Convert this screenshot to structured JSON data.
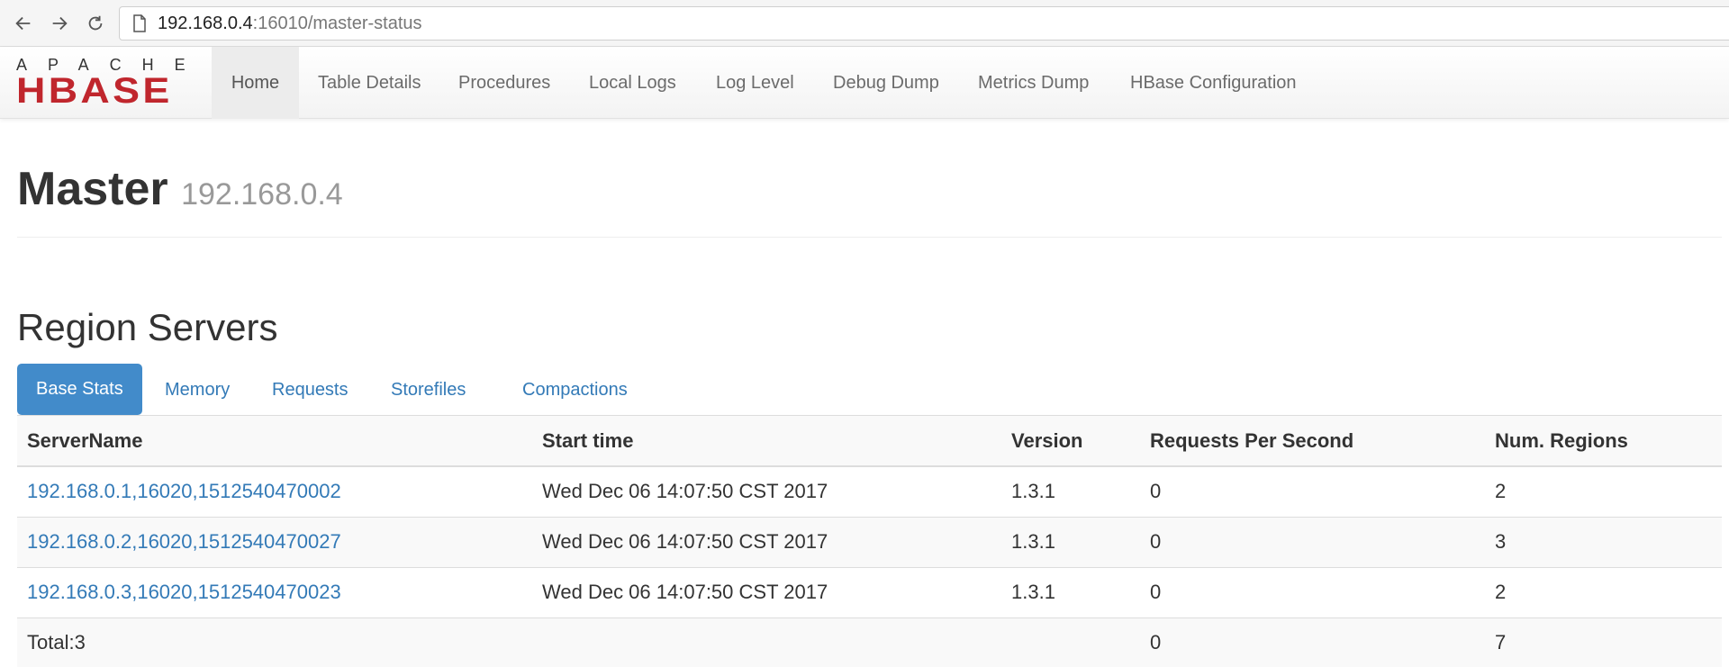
{
  "browser": {
    "url_host": "192.168.0.4",
    "url_path": ":16010/master-status"
  },
  "logo": {
    "top_text": "APACHE",
    "main_text": "HBASE",
    "brand_color": "#c0262d"
  },
  "nav": {
    "items": [
      {
        "label": "Home",
        "active": true
      },
      {
        "label": "Table Details"
      },
      {
        "label": "Procedures"
      },
      {
        "label": "Local Logs"
      },
      {
        "label": "Log Level"
      },
      {
        "label": "Debug Dump"
      },
      {
        "label": "Metrics Dump"
      },
      {
        "label": "HBase Configuration"
      }
    ]
  },
  "header": {
    "title": "Master",
    "subtitle": "192.168.0.4"
  },
  "region_servers": {
    "title": "Region Servers",
    "tabs": [
      {
        "label": "Base Stats",
        "active": true
      },
      {
        "label": "Memory"
      },
      {
        "label": "Requests"
      },
      {
        "label": "Storefiles"
      },
      {
        "label": "Compactions"
      }
    ],
    "columns": [
      "ServerName",
      "Start time",
      "Version",
      "Requests Per Second",
      "Num. Regions"
    ],
    "rows": [
      {
        "server": "192.168.0.1,16020,1512540470002",
        "start": "Wed Dec 06 14:07:50 CST 2017",
        "version": "1.3.1",
        "rps": "0",
        "regions": "2"
      },
      {
        "server": "192.168.0.2,16020,1512540470027",
        "start": "Wed Dec 06 14:07:50 CST 2017",
        "version": "1.3.1",
        "rps": "0",
        "regions": "3"
      },
      {
        "server": "192.168.0.3,16020,1512540470023",
        "start": "Wed Dec 06 14:07:50 CST 2017",
        "version": "1.3.1",
        "rps": "0",
        "regions": "2"
      }
    ],
    "total": {
      "label": "Total:3",
      "rps": "0",
      "regions": "7"
    }
  },
  "colors": {
    "link": "#337ab7",
    "active_tab": "#428bca"
  }
}
